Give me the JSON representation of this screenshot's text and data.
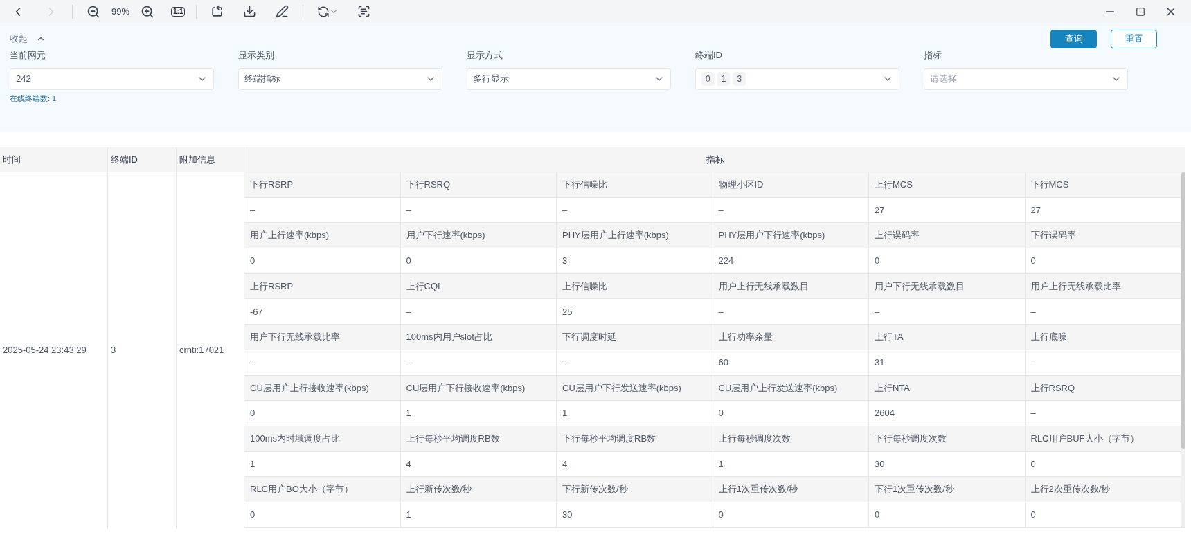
{
  "toolbar": {
    "zoom": "99%",
    "actual_size": "1:1",
    "forward_disabled": true
  },
  "filter_panel": {
    "collapse": "收起",
    "buttons": [
      {
        "label": "查询",
        "kind": "primary"
      },
      {
        "label": "重置",
        "kind": "outline"
      }
    ],
    "fields": [
      {
        "label": "当前网元",
        "kind": "select",
        "value": "242"
      },
      {
        "label": "显示类别",
        "kind": "select",
        "value": "终端指标"
      },
      {
        "label": "显示方式",
        "kind": "select",
        "value": "多行显示"
      },
      {
        "label": "终端ID",
        "kind": "tags",
        "tags": [
          "0",
          "1",
          "3"
        ]
      },
      {
        "label": "指标",
        "kind": "select",
        "placeholder": "请选择"
      }
    ],
    "online_count": "在线终端数: 1"
  },
  "table": {
    "columns": [
      "时间",
      "终端ID",
      "附加信息",
      "指标"
    ],
    "row": {
      "time": "2025-05-24 23:43:29",
      "terminal_id": "3",
      "extra": "crnti:17021"
    },
    "metric_groups": [
      {
        "labels": [
          "下行RSRP",
          "下行RSRQ",
          "下行信噪比",
          "物理小区ID",
          "上行MCS",
          "下行MCS"
        ],
        "values": [
          "–",
          "–",
          "–",
          "–",
          "27",
          "27"
        ]
      },
      {
        "labels": [
          "用户上行速率(kbps)",
          "用户下行速率(kbps)",
          "PHY层用户上行速率(kbps)",
          "PHY层用户下行速率(kbps)",
          "上行误码率",
          "下行误码率"
        ],
        "values": [
          "0",
          "0",
          "3",
          "224",
          "0",
          "0"
        ]
      },
      {
        "labels": [
          "上行RSRP",
          "上行CQI",
          "上行信噪比",
          "用户上行无线承载数目",
          "用户下行无线承载数目",
          "用户上行无线承载比率"
        ],
        "values": [
          "-67",
          "–",
          "25",
          "–",
          "–",
          "–"
        ]
      },
      {
        "labels": [
          "用户下行无线承载比率",
          "100ms内用户slot占比",
          "下行调度时延",
          "上行功率余量",
          "上行TA",
          "上行底噪"
        ],
        "values": [
          "–",
          "–",
          "–",
          "60",
          "31",
          "–"
        ]
      },
      {
        "labels": [
          "CU层用户上行接收速率(kbps)",
          "CU层用户下行接收速率(kbps)",
          "CU层用户下行发送速率(kbps)",
          "CU层用户上行发送速率(kbps)",
          "上行NTA",
          "上行RSRQ"
        ],
        "values": [
          "0",
          "1",
          "1",
          "0",
          "2604",
          "–"
        ]
      },
      {
        "labels": [
          "100ms内时域调度占比",
          "上行每秒平均调度RB数",
          "下行每秒平均调度RB数",
          "上行每秒调度次数",
          "下行每秒调度次数",
          "RLC用户BUF大小（字节）"
        ],
        "values": [
          "1",
          "4",
          "4",
          "1",
          "30",
          "0"
        ]
      },
      {
        "labels": [
          "RLC用户BO大小（字节）",
          "上行新传次数/秒",
          "下行新传次数/秒",
          "上行1次重传次数/秒",
          "下行1次重传次数/秒",
          "上行2次重传次数/秒"
        ],
        "values": [
          "0",
          "1",
          "30",
          "0",
          "0",
          "0"
        ]
      }
    ]
  }
}
